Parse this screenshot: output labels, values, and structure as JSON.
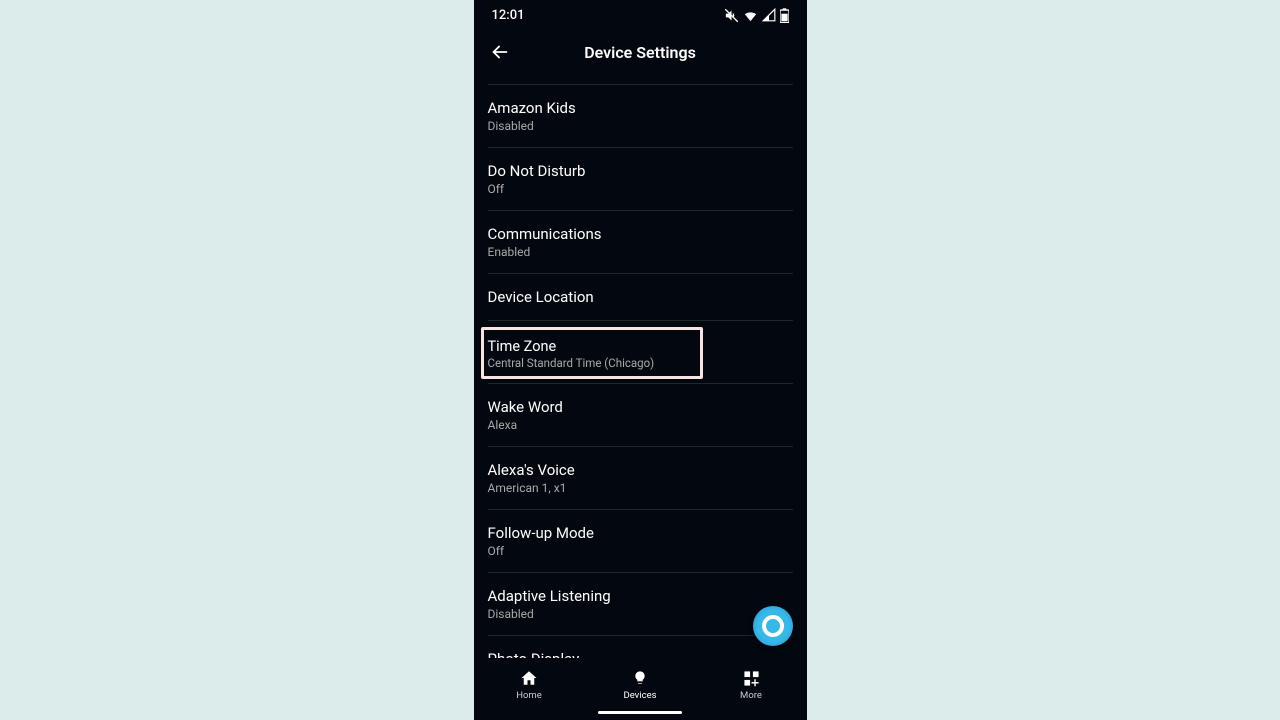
{
  "status": {
    "time": "12:01"
  },
  "header": {
    "title": "Device Settings"
  },
  "settings": [
    {
      "title": "Amazon Kids",
      "subtitle": "Disabled"
    },
    {
      "title": "Do Not Disturb",
      "subtitle": "Off"
    },
    {
      "title": "Communications",
      "subtitle": "Enabled"
    },
    {
      "title": "Device Location",
      "subtitle": ""
    },
    {
      "title": "Time Zone",
      "subtitle": "Central Standard Time (Chicago)",
      "highlighted": true
    },
    {
      "title": "Wake Word",
      "subtitle": "Alexa"
    },
    {
      "title": "Alexa's Voice",
      "subtitle": "American 1, x1"
    },
    {
      "title": "Follow-up Mode",
      "subtitle": "Off"
    },
    {
      "title": "Adaptive Listening",
      "subtitle": "Disabled"
    },
    {
      "title": "Photo Display",
      "subtitle": ""
    }
  ],
  "nav": {
    "home": "Home",
    "devices": "Devices",
    "more": "More"
  }
}
